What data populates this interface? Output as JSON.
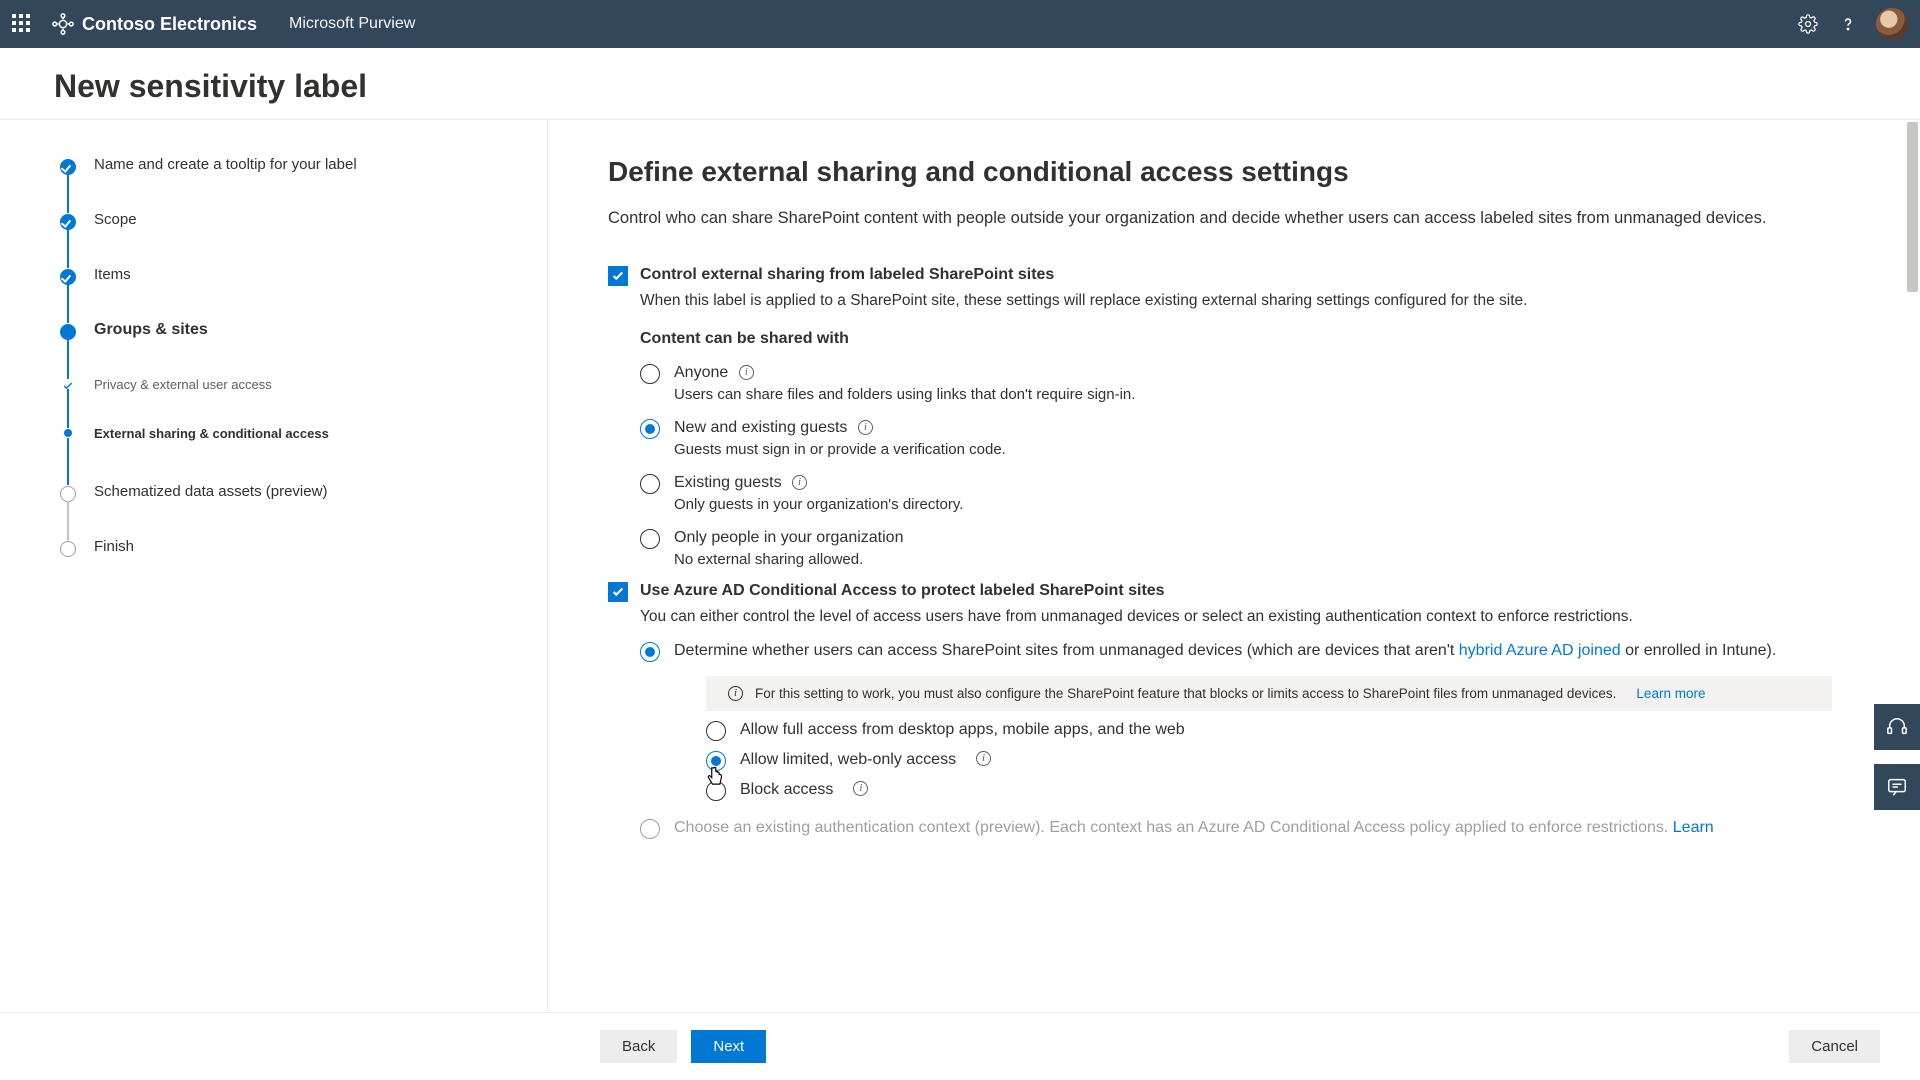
{
  "header": {
    "brand": "Contoso Electronics",
    "product": "Microsoft Purview"
  },
  "page_title": "New sensitivity label",
  "steps": [
    {
      "label": "Name and create a tooltip for your label",
      "state": "done"
    },
    {
      "label": "Scope",
      "state": "done"
    },
    {
      "label": "Items",
      "state": "done"
    },
    {
      "label": "Groups & sites",
      "state": "current",
      "substeps": [
        {
          "label": "Privacy & external user access",
          "state": "done"
        },
        {
          "label": "External sharing & conditional access",
          "state": "current"
        }
      ]
    },
    {
      "label": "Schematized data assets (preview)",
      "state": "pending"
    },
    {
      "label": "Finish",
      "state": "pending"
    }
  ],
  "content": {
    "heading": "Define external sharing and conditional access settings",
    "description": "Control who can share SharePoint content with people outside your organization and decide whether users can access labeled sites from unmanaged devices.",
    "checkbox1": {
      "label": "Control external sharing from labeled SharePoint sites",
      "hint": "When this label is applied to a SharePoint site, these settings will replace existing external sharing settings configured for the site.",
      "subtitle": "Content can be shared with",
      "radios": [
        {
          "label": "Anyone",
          "hint": "Users can share files and folders using links that don't require sign-in.",
          "selected": false
        },
        {
          "label": "New and existing guests",
          "hint": "Guests must sign in or provide a verification code.",
          "selected": true
        },
        {
          "label": "Existing guests",
          "hint": "Only guests in your organization's directory.",
          "selected": false
        },
        {
          "label": "Only people in your organization",
          "hint": "No external sharing allowed.",
          "selected": false
        }
      ]
    },
    "checkbox2": {
      "label": "Use Azure AD Conditional Access to protect labeled SharePoint sites",
      "hint": "You can either control the level of access users have from unmanaged devices or select an existing authentication context to enforce restrictions.",
      "option1_prefix": "Determine whether users can access SharePoint sites from unmanaged devices (which are devices that aren't ",
      "option1_link": "hybrid Azure AD joined",
      "option1_suffix": " or enrolled in Intune).",
      "note": "For this setting to work, you must also configure the SharePoint feature that blocks or limits access to SharePoint files from unmanaged devices.",
      "note_link": "Learn more",
      "sub_radios": [
        {
          "label": "Allow full access from desktop apps, mobile apps, and the web",
          "selected": false,
          "info": false
        },
        {
          "label": "Allow limited, web-only access",
          "selected": true,
          "info": true
        },
        {
          "label": "Block access",
          "selected": false,
          "info": true
        }
      ],
      "option2_prefix": "Choose an existing authentication context (preview). Each context has an Azure AD Conditional Access policy applied to enforce restrictions. ",
      "option2_link": "Learn"
    }
  },
  "footer": {
    "back": "Back",
    "next": "Next",
    "cancel": "Cancel"
  }
}
